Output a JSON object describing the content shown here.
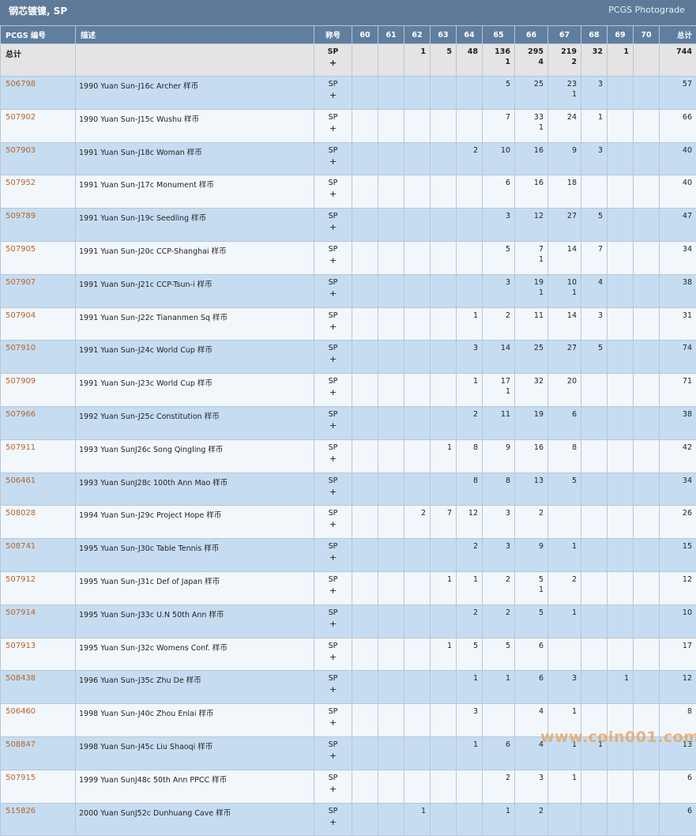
{
  "header": {
    "title": "钢芯镀镍, SP",
    "subtitle": "PCGS Photograde"
  },
  "columns": {
    "code": "PCGS 编号",
    "desc": "描述",
    "designation": "称号",
    "grades": [
      "60",
      "61",
      "62",
      "63",
      "64",
      "65",
      "66",
      "67",
      "68",
      "69",
      "70"
    ],
    "total": "总计"
  },
  "totals_row": {
    "label": "总计",
    "des1": "SP",
    "des2": "+",
    "g1": [
      "",
      "",
      "1",
      "5",
      "48",
      "136",
      "295",
      "219",
      "32",
      "1",
      ""
    ],
    "g2": [
      "",
      "",
      "",
      "",
      "",
      "1",
      "4",
      "2",
      "",
      "",
      ""
    ],
    "total": "744"
  },
  "rows": [
    {
      "code": "506798",
      "desc": "1990 Yuan Sun-J16c Archer 样币",
      "g1": [
        "",
        "",
        "",
        "",
        "",
        "5",
        "25",
        "23",
        "3",
        "",
        ""
      ],
      "g2": [
        "",
        "",
        "",
        "",
        "",
        "",
        "",
        "1",
        "",
        "",
        ""
      ],
      "total": "57"
    },
    {
      "code": "507902",
      "desc": "1990 Yuan Sun-J15c Wushu 样币",
      "g1": [
        "",
        "",
        "",
        "",
        "",
        "7",
        "33",
        "24",
        "1",
        "",
        ""
      ],
      "g2": [
        "",
        "",
        "",
        "",
        "",
        "",
        "1",
        "",
        "",
        "",
        ""
      ],
      "total": "66"
    },
    {
      "code": "507903",
      "desc": "1991 Yuan Sun-J18c Woman 样币",
      "g1": [
        "",
        "",
        "",
        "",
        "2",
        "10",
        "16",
        "9",
        "3",
        "",
        ""
      ],
      "g2": [
        "",
        "",
        "",
        "",
        "",
        "",
        "",
        "",
        "",
        "",
        ""
      ],
      "total": "40"
    },
    {
      "code": "507952",
      "desc": "1991 Yuan Sun-J17c Monument 样币",
      "g1": [
        "",
        "",
        "",
        "",
        "",
        "6",
        "16",
        "18",
        "",
        "",
        ""
      ],
      "g2": [
        "",
        "",
        "",
        "",
        "",
        "",
        "",
        "",
        "",
        "",
        ""
      ],
      "total": "40"
    },
    {
      "code": "509789",
      "desc": "1991 Yuan Sun-J19c Seedling 样币",
      "g1": [
        "",
        "",
        "",
        "",
        "",
        "3",
        "12",
        "27",
        "5",
        "",
        ""
      ],
      "g2": [
        "",
        "",
        "",
        "",
        "",
        "",
        "",
        "",
        "",
        "",
        ""
      ],
      "total": "47"
    },
    {
      "code": "507905",
      "desc": "1991 Yuan Sun-J20c CCP-Shanghai 样币",
      "g1": [
        "",
        "",
        "",
        "",
        "",
        "5",
        "7",
        "14",
        "7",
        "",
        ""
      ],
      "g2": [
        "",
        "",
        "",
        "",
        "",
        "",
        "1",
        "",
        "",
        "",
        ""
      ],
      "total": "34"
    },
    {
      "code": "507907",
      "desc": "1991 Yuan Sun-J21c CCP-Tsun-i 样币",
      "g1": [
        "",
        "",
        "",
        "",
        "",
        "3",
        "19",
        "10",
        "4",
        "",
        ""
      ],
      "g2": [
        "",
        "",
        "",
        "",
        "",
        "",
        "1",
        "1",
        "",
        "",
        ""
      ],
      "total": "38"
    },
    {
      "code": "507904",
      "desc": "1991 Yuan Sun-J22c Tiananmen Sq 样币",
      "g1": [
        "",
        "",
        "",
        "",
        "1",
        "2",
        "11",
        "14",
        "3",
        "",
        ""
      ],
      "g2": [
        "",
        "",
        "",
        "",
        "",
        "",
        "",
        "",
        "",
        "",
        ""
      ],
      "total": "31"
    },
    {
      "code": "507910",
      "desc": "1991 Yuan Sun-J24c World Cup 样币",
      "g1": [
        "",
        "",
        "",
        "",
        "3",
        "14",
        "25",
        "27",
        "5",
        "",
        ""
      ],
      "g2": [
        "",
        "",
        "",
        "",
        "",
        "",
        "",
        "",
        "",
        "",
        ""
      ],
      "total": "74"
    },
    {
      "code": "507909",
      "desc": "1991 Yuan Sun-J23c World Cup 样币",
      "g1": [
        "",
        "",
        "",
        "",
        "1",
        "17",
        "32",
        "20",
        "",
        "",
        ""
      ],
      "g2": [
        "",
        "",
        "",
        "",
        "",
        "1",
        "",
        "",
        "",
        "",
        ""
      ],
      "total": "71"
    },
    {
      "code": "507966",
      "desc": "1992 Yuan Sun-J25c Constitution 样币",
      "g1": [
        "",
        "",
        "",
        "",
        "2",
        "11",
        "19",
        "6",
        "",
        "",
        ""
      ],
      "g2": [
        "",
        "",
        "",
        "",
        "",
        "",
        "",
        "",
        "",
        "",
        ""
      ],
      "total": "38"
    },
    {
      "code": "507911",
      "desc": "1993 Yuan SunJ26c Song Qingling 样币",
      "g1": [
        "",
        "",
        "",
        "1",
        "8",
        "9",
        "16",
        "8",
        "",
        "",
        ""
      ],
      "g2": [
        "",
        "",
        "",
        "",
        "",
        "",
        "",
        "",
        "",
        "",
        ""
      ],
      "total": "42"
    },
    {
      "code": "506461",
      "desc": "1993 Yuan SunJ28c 100th Ann Mao 样币",
      "g1": [
        "",
        "",
        "",
        "",
        "8",
        "8",
        "13",
        "5",
        "",
        "",
        ""
      ],
      "g2": [
        "",
        "",
        "",
        "",
        "",
        "",
        "",
        "",
        "",
        "",
        ""
      ],
      "total": "34"
    },
    {
      "code": "508028",
      "desc": "1994 Yuan Sun-J29c Project Hope 样币",
      "g1": [
        "",
        "",
        "2",
        "7",
        "12",
        "3",
        "2",
        "",
        "",
        "",
        ""
      ],
      "g2": [
        "",
        "",
        "",
        "",
        "",
        "",
        "",
        "",
        "",
        "",
        ""
      ],
      "total": "26",
      "shift": true
    },
    {
      "code": "508741",
      "desc": "1995 Yuan Sun-J30c Table Tennis 样币",
      "g1": [
        "",
        "",
        "",
        "",
        "2",
        "3",
        "9",
        "1",
        "",
        "",
        ""
      ],
      "g2": [
        "",
        "",
        "",
        "",
        "",
        "",
        "",
        "",
        "",
        "",
        ""
      ],
      "total": "15"
    },
    {
      "code": "507912",
      "desc": "1995 Yuan Sun-J31c Def of Japan 样币",
      "g1": [
        "",
        "",
        "",
        "1",
        "1",
        "2",
        "5",
        "2",
        "",
        "",
        ""
      ],
      "g2": [
        "",
        "",
        "",
        "",
        "",
        "",
        "1",
        "",
        "",
        "",
        ""
      ],
      "total": "12"
    },
    {
      "code": "507914",
      "desc": "1995 Yuan Sun-J33c U.N 50th Ann 样币",
      "g1": [
        "",
        "",
        "",
        "",
        "2",
        "2",
        "5",
        "1",
        "",
        "",
        ""
      ],
      "g2": [
        "",
        "",
        "",
        "",
        "",
        "",
        "",
        "",
        "",
        "",
        ""
      ],
      "total": "10"
    },
    {
      "code": "507913",
      "desc": "1995 Yuan Sun-J32c Womens Conf. 样币",
      "g1": [
        "",
        "",
        "",
        "1",
        "5",
        "5",
        "6",
        "",
        "",
        "",
        ""
      ],
      "g2": [
        "",
        "",
        "",
        "",
        "",
        "",
        "",
        "",
        "",
        "",
        ""
      ],
      "total": "17"
    },
    {
      "code": "508438",
      "desc": "1996 Yuan Sun-J35c Zhu De 样币",
      "g1": [
        "",
        "",
        "",
        "",
        "1",
        "1",
        "6",
        "3",
        "",
        "1",
        ""
      ],
      "g2": [
        "",
        "",
        "",
        "",
        "",
        "",
        "",
        "",
        "",
        "",
        ""
      ],
      "total": "12"
    },
    {
      "code": "506460",
      "desc": "1998 Yuan Sun-J40c Zhou Enlai 样币",
      "g1": [
        "",
        "",
        "",
        "",
        "3",
        "",
        "4",
        "1",
        "",
        "",
        ""
      ],
      "g2": [
        "",
        "",
        "",
        "",
        "",
        "",
        "",
        "",
        "",
        "",
        ""
      ],
      "total": "8"
    },
    {
      "code": "508847",
      "desc": "1998 Yuan Sun-J45c Liu Shaoqi 样币",
      "g1": [
        "",
        "",
        "",
        "",
        "1",
        "6",
        "4",
        "1",
        "1",
        "",
        ""
      ],
      "g2": [
        "",
        "",
        "",
        "",
        "",
        "",
        "",
        "",
        "",
        "",
        ""
      ],
      "total": "13"
    },
    {
      "code": "507915",
      "desc": "1999 Yuan SunJ48c 50th Ann PPCC 样币",
      "g1": [
        "",
        "",
        "",
        "",
        "",
        "2",
        "3",
        "1",
        "",
        "",
        ""
      ],
      "g2": [
        "",
        "",
        "",
        "",
        "",
        "",
        "",
        "",
        "",
        "",
        ""
      ],
      "total": "6"
    },
    {
      "code": "515826",
      "desc": "2000 Yuan SunJ52c Dunhuang Cave 样币",
      "g1": [
        "",
        "",
        "1",
        "",
        "",
        "1",
        "2",
        "",
        "",
        "",
        ""
      ],
      "g2": [
        "",
        "",
        "",
        "",
        "",
        "",
        "",
        "",
        "",
        "",
        ""
      ],
      "total": "6"
    }
  ],
  "designation": {
    "line1": "SP",
    "line2": "+"
  },
  "watermark": "www.coin001.com"
}
